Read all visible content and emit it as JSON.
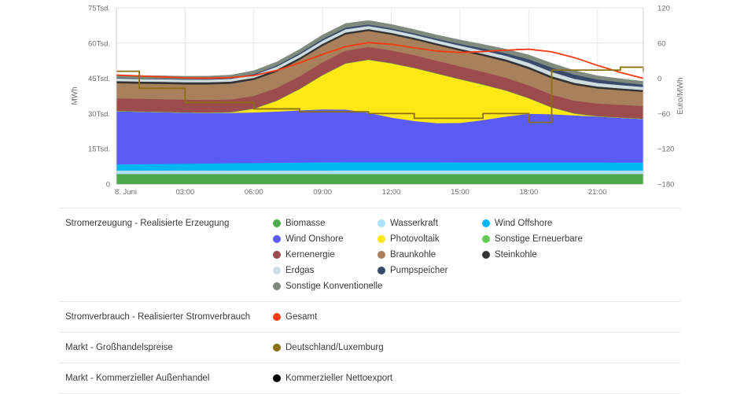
{
  "chart_data": {
    "type": "area",
    "title": "",
    "subtitle": "",
    "xlabel": "",
    "ylabel": "MWh",
    "y2label": "Euro/MWh",
    "grid": true,
    "legend_position": "bottom",
    "ylim": [
      0,
      75000
    ],
    "y2lim": [
      -180,
      120
    ],
    "yticks": [
      0,
      15000,
      30000,
      45000,
      60000,
      75000
    ],
    "ytick_labels": [
      "0",
      "15Tsd.",
      "30Tsd.",
      "45Tsd.",
      "60Tsd.",
      "75Tsd."
    ],
    "y2ticks": [
      -180,
      -120,
      -60,
      0,
      60,
      120
    ],
    "y2tick_labels": [
      "−180",
      "−120",
      "−60",
      "0",
      "60",
      "120"
    ],
    "x": [
      "00:00",
      "01:00",
      "02:00",
      "03:00",
      "04:00",
      "05:00",
      "06:00",
      "07:00",
      "08:00",
      "09:00",
      "10:00",
      "11:00",
      "12:00",
      "13:00",
      "14:00",
      "15:00",
      "16:00",
      "17:00",
      "18:00",
      "19:00",
      "20:00",
      "21:00",
      "22:00",
      "23:00"
    ],
    "xtick_labels": [
      "8. Juni",
      "03:00",
      "06:00",
      "09:00",
      "12:00",
      "15:00",
      "18:00",
      "21:00"
    ],
    "xtick_positions": [
      0,
      3,
      6,
      9,
      12,
      15,
      18,
      21
    ],
    "stack_order": [
      "Biomasse",
      "Wasserkraft",
      "Wind Offshore",
      "Wind Onshore",
      "Photovoltaik",
      "Sonstige Erneuerbare",
      "Kernenergie",
      "Braunkohle",
      "Steinkohle",
      "Erdgas",
      "Pumpspeicher",
      "Sonstige Konventionelle"
    ],
    "series": [
      {
        "name": "Biomasse",
        "color": "#4ea84e",
        "values": [
          4300,
          4300,
          4300,
          4300,
          4300,
          4300,
          4300,
          4300,
          4300,
          4300,
          4300,
          4300,
          4300,
          4300,
          4300,
          4300,
          4300,
          4300,
          4300,
          4300,
          4300,
          4300,
          4300,
          4300
        ]
      },
      {
        "name": "Wasserkraft",
        "color": "#ace0f5",
        "values": [
          1500,
          1500,
          1500,
          1500,
          1500,
          1500,
          1500,
          1500,
          1500,
          1500,
          1550,
          1550,
          1550,
          1550,
          1550,
          1550,
          1550,
          1550,
          1550,
          1550,
          1550,
          1550,
          1500,
          1500
        ]
      },
      {
        "name": "Wind Offshore",
        "color": "#00b6f0",
        "values": [
          2600,
          2700,
          2800,
          2900,
          3000,
          3100,
          3200,
          3300,
          3400,
          3500,
          3500,
          3500,
          3500,
          3500,
          3500,
          3400,
          3400,
          3400,
          3400,
          3400,
          3400,
          3400,
          3400,
          3400
        ]
      },
      {
        "name": "Wind Onshore",
        "color": "#5b5bf5",
        "values": [
          22600,
          22300,
          22000,
          21700,
          21500,
          21400,
          21500,
          21800,
          22200,
          22500,
          22400,
          21000,
          19000,
          17500,
          16600,
          16800,
          18000,
          19500,
          20700,
          20500,
          20000,
          19500,
          19000,
          18500
        ]
      },
      {
        "name": "Photovoltaik",
        "color": "#ffe814",
        "values": [
          0,
          0,
          0,
          0,
          0,
          200,
          1500,
          4500,
          9000,
          14500,
          19500,
          22500,
          23000,
          22500,
          21000,
          18500,
          15000,
          11000,
          6500,
          2800,
          700,
          0,
          0,
          0
        ]
      },
      {
        "name": "Sonstige Erneuerbare",
        "color": "#66cc55",
        "values": [
          150,
          150,
          150,
          150,
          150,
          150,
          150,
          150,
          150,
          150,
          150,
          150,
          150,
          150,
          150,
          150,
          150,
          150,
          150,
          150,
          150,
          150,
          150,
          150
        ]
      },
      {
        "name": "Kernenergie",
        "color": "#9c4c4c",
        "values": [
          5400,
          5400,
          5400,
          5400,
          5400,
          5400,
          5400,
          5400,
          5400,
          5400,
          5400,
          5400,
          5400,
          5400,
          5400,
          5400,
          5400,
          5400,
          5400,
          5400,
          5400,
          5400,
          5400,
          5400
        ]
      },
      {
        "name": "Braunkohle",
        "color": "#a8805c",
        "values": [
          6400,
          6400,
          6500,
          6500,
          6600,
          6700,
          6800,
          6900,
          7000,
          7000,
          6900,
          6800,
          6700,
          6600,
          6600,
          6700,
          6800,
          6900,
          7000,
          6900,
          6700,
          6400,
          6200,
          6000
        ]
      },
      {
        "name": "Steinkohle",
        "color": "#333333",
        "values": [
          900,
          900,
          900,
          900,
          900,
          900,
          900,
          900,
          900,
          900,
          850,
          800,
          800,
          800,
          800,
          800,
          850,
          900,
          950,
          950,
          900,
          850,
          800,
          800
        ]
      },
      {
        "name": "Erdgas",
        "color": "#cfdde0",
        "values": [
          1100,
          1100,
          1100,
          1100,
          1100,
          1150,
          1200,
          1250,
          1300,
          1350,
          1350,
          1300,
          1300,
          1300,
          1300,
          1350,
          1400,
          1500,
          1700,
          1800,
          1700,
          1500,
          1400,
          1300
        ]
      },
      {
        "name": "Pumpspeicher",
        "color": "#3a4a6b",
        "values": [
          250,
          250,
          250,
          250,
          250,
          300,
          400,
          500,
          600,
          700,
          700,
          650,
          600,
          600,
          650,
          750,
          900,
          1100,
          1500,
          1900,
          1800,
          1500,
          1200,
          1000
        ]
      },
      {
        "name": "Sonstige Konventionelle",
        "color": "#7d8a7d",
        "values": [
          1200,
          1200,
          1200,
          1200,
          1250,
          1300,
          1400,
          1500,
          1600,
          1700,
          1750,
          1700,
          1650,
          1600,
          1600,
          1650,
          1700,
          1750,
          1800,
          1800,
          1700,
          1550,
          1450,
          1400
        ]
      }
    ],
    "lines": [
      {
        "name": "Gesamt",
        "axis": "left",
        "color": "#f53a12",
        "values": [
          46400,
          46000,
          45600,
          45200,
          45100,
          45300,
          46200,
          48400,
          51600,
          55200,
          58500,
          60200,
          59500,
          58000,
          56600,
          56000,
          56400,
          57000,
          57400,
          56300,
          53800,
          50500,
          47500,
          45000
        ]
      },
      {
        "name": "Deutschland/Luxemburg",
        "axis": "right",
        "color": "#8a7012",
        "step": true,
        "values": [
          12,
          -17,
          -17,
          -41,
          -41,
          -41,
          -52,
          -52,
          -57,
          -57,
          -57,
          -60,
          -60,
          -68,
          -68,
          -68,
          -60,
          -60,
          -75,
          14,
          14,
          14,
          19,
          11
        ]
      },
      {
        "name": "Kommerzieller Nettoexport",
        "axis": "right",
        "color": "#000000",
        "values": []
      }
    ]
  },
  "legend": {
    "sections": [
      {
        "category": "Stromerzeugung - Realisierte Erzeugung",
        "items": [
          {
            "label": "Biomasse",
            "color": "#4ea84e"
          },
          {
            "label": "Wasserkraft",
            "color": "#ace0f5"
          },
          {
            "label": "Wind Offshore",
            "color": "#00b6f0"
          },
          {
            "label": "Wind Onshore",
            "color": "#5b5bf5"
          },
          {
            "label": "Photovoltaik",
            "color": "#ffe814"
          },
          {
            "label": "Sonstige Erneuerbare",
            "color": "#66cc55"
          },
          {
            "label": "Kernenergie",
            "color": "#9c4c4c"
          },
          {
            "label": "Braunkohle",
            "color": "#a8805c"
          },
          {
            "label": "Steinkohle",
            "color": "#333333"
          },
          {
            "label": "Erdgas",
            "color": "#cfdde0"
          },
          {
            "label": "Pumpspeicher",
            "color": "#3a4a6b"
          },
          {
            "label": "Sonstige Konventionelle",
            "color": "#7d8a7d"
          }
        ]
      },
      {
        "category": "Stromverbrauch - Realisierter Stromverbrauch",
        "items": [
          {
            "label": "Gesamt",
            "color": "#f53a12"
          }
        ]
      },
      {
        "category": "Markt - Großhandelspreise",
        "items": [
          {
            "label": "Deutschland/Luxemburg",
            "color": "#8a7012"
          }
        ]
      },
      {
        "category": "Markt - Kommerzieller Außenhandel",
        "items": [
          {
            "label": "Kommerzieller Nettoexport",
            "color": "#000000"
          }
        ]
      }
    ]
  }
}
